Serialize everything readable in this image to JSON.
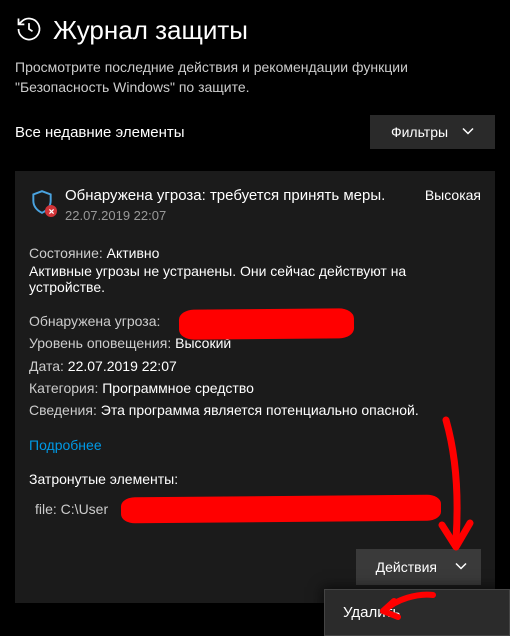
{
  "header": {
    "title": "Журнал защиты",
    "subtitle": "Просмотрите последние действия и рекомендации функции \"Безопасность Windows\" по защите."
  },
  "filter_bar": {
    "recent_label": "Все недавние элементы",
    "filter_button": "Фильтры"
  },
  "threat": {
    "title": "Обнаружена угроза: требуется принять меры.",
    "timestamp": "22.07.2019 22:07",
    "severity": "Высокая",
    "status_label": "Состояние:",
    "status_value": "Активно",
    "status_desc": "Активные угрозы не устранены. Они сейчас действуют на устройстве.",
    "details": {
      "detected_label": "Обнаружена угроза:",
      "detected_value": "",
      "level_label": "Уровень оповещения:",
      "level_value": "Высокий",
      "date_label": "Дата:",
      "date_value": "22.07.2019 22:07",
      "category_label": "Категория:",
      "category_value": "Программное средство",
      "info_label": "Сведения:",
      "info_value": "Эта программа является потенциально опасной."
    },
    "more_link": "Подробнее",
    "affected_title": "Затронутые элементы:",
    "affected_file": "file: C:\\User",
    "actions_button": "Действия",
    "dropdown": {
      "delete": "Удалить"
    }
  }
}
